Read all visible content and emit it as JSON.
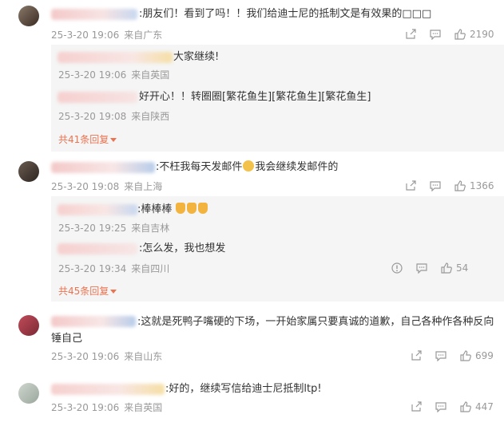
{
  "comments": [
    {
      "text": ":朋友们！看到了吗！！我们给迪士尼的抵制文是有效果的□□□",
      "date": "25-3-20 19:06",
      "location": "来自广东",
      "likes": "2190",
      "replies": [
        {
          "text": "大家继续!",
          "date": "25-3-20 19:06",
          "location": "来自英国"
        },
        {
          "text": "好开心！！转圈圈[繁花鱼生][繁花鱼生][繁花鱼生]",
          "date": "25-3-20 19:08",
          "location": "来自陕西"
        }
      ],
      "more": "共41条回复"
    },
    {
      "text_a": ":不枉我每天发邮件",
      "text_b": "我会继续发邮件的",
      "date": "25-3-20 19:08",
      "location": "来自上海",
      "likes": "1366",
      "replies": [
        {
          "text": ":棒棒棒",
          "date": "25-3-20 19:25",
          "location": "来自吉林"
        },
        {
          "text": ":怎么发，我也想发",
          "date": "25-3-20 19:34",
          "location": "来自四川",
          "likes": "54"
        }
      ],
      "more": "共45条回复"
    },
    {
      "text": ":这就是死鸭子嘴硬的下场，一开始家属只要真诚的道歉，自己各种作各种反向锤自己",
      "date": "25-3-20 19:06",
      "location": "来自山东",
      "likes": "699"
    },
    {
      "text": ":好的，继续写信给迪士尼抵制ltp!",
      "date": "25-3-20 19:06",
      "location": "来自英国",
      "likes": "447"
    }
  ],
  "icons": {
    "share": "share-icon",
    "comment": "comment-icon",
    "like": "thumbs-up-icon",
    "report": "report-icon"
  },
  "colors": {
    "more_link": "#eb7350",
    "meta": "#999999",
    "reply_bg": "#f5f5f5"
  }
}
